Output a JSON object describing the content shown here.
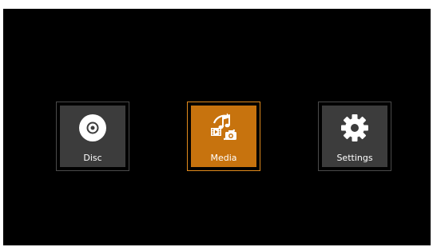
{
  "menu": {
    "items": [
      {
        "label": "Disc",
        "icon": "disc-icon",
        "selected": false
      },
      {
        "label": "Media",
        "icon": "media-icon",
        "selected": true
      },
      {
        "label": "Settings",
        "icon": "gear-icon",
        "selected": false
      }
    ]
  },
  "colors": {
    "background": "#000000",
    "tile": "#3c3c3c",
    "selected_tile": "#c7730e",
    "selected_border": "#e08a1c",
    "text": "#ffffff"
  }
}
